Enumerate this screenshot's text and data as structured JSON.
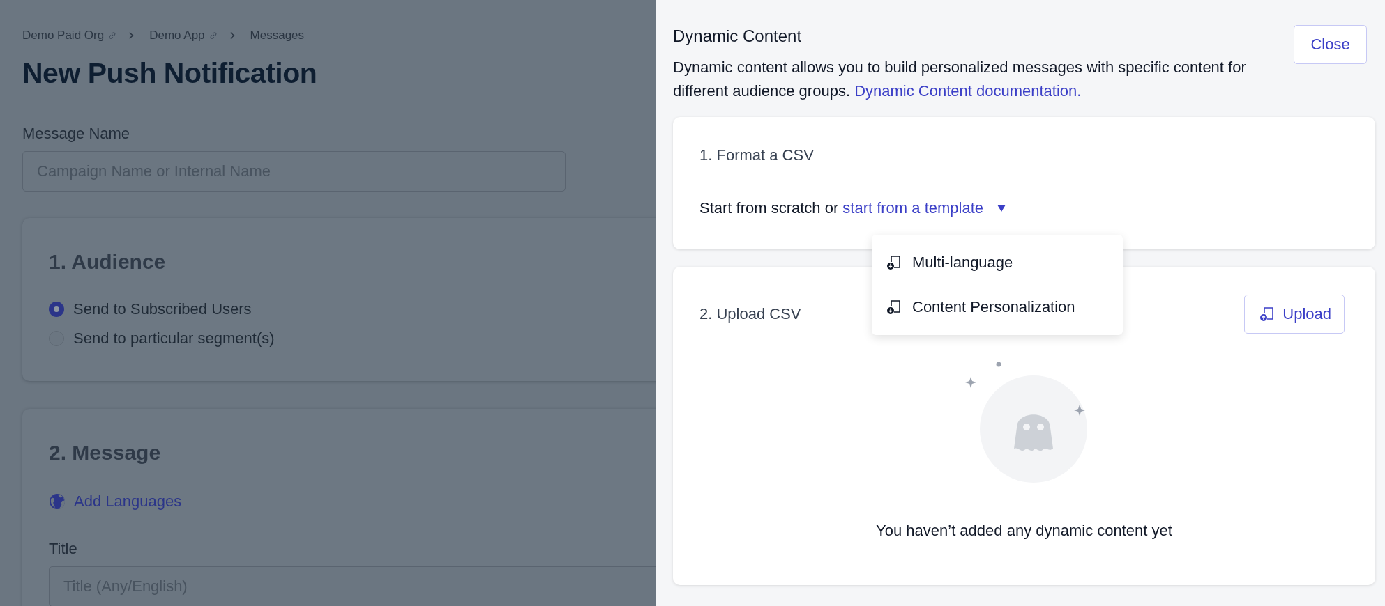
{
  "breadcrumb": [
    {
      "label": "Demo Paid Org",
      "linked": true
    },
    {
      "label": "Demo App",
      "linked": true
    },
    {
      "label": "Messages",
      "linked": false
    }
  ],
  "page_title": "New Push Notification",
  "message_name": {
    "label": "Message Name",
    "placeholder": "Campaign Name or Internal Name"
  },
  "audience": {
    "heading": "1. Audience",
    "options": [
      {
        "label": "Send to Subscribed Users",
        "selected": true
      },
      {
        "label": "Send to particular segment(s)",
        "selected": false
      }
    ]
  },
  "message": {
    "heading": "2. Message",
    "add_languages": "Add Languages",
    "title_field": {
      "label": "Title",
      "placeholder": "Title (Any/English)"
    }
  },
  "drawer": {
    "title": "Dynamic Content",
    "close": "Close",
    "description": "Dynamic content allows you to build personalized messages with specific content for different audience groups.",
    "doc_link": "Dynamic Content documentation.",
    "format_step": {
      "heading": "1. Format a CSV",
      "prefix": "Start from scratch or",
      "template_link": "start from a template",
      "menu": [
        "Multi-language",
        "Content Personalization"
      ]
    },
    "upload_step": {
      "heading": "2. Upload CSV",
      "upload": "Upload",
      "empty": "You haven’t added any dynamic content yet"
    }
  }
}
